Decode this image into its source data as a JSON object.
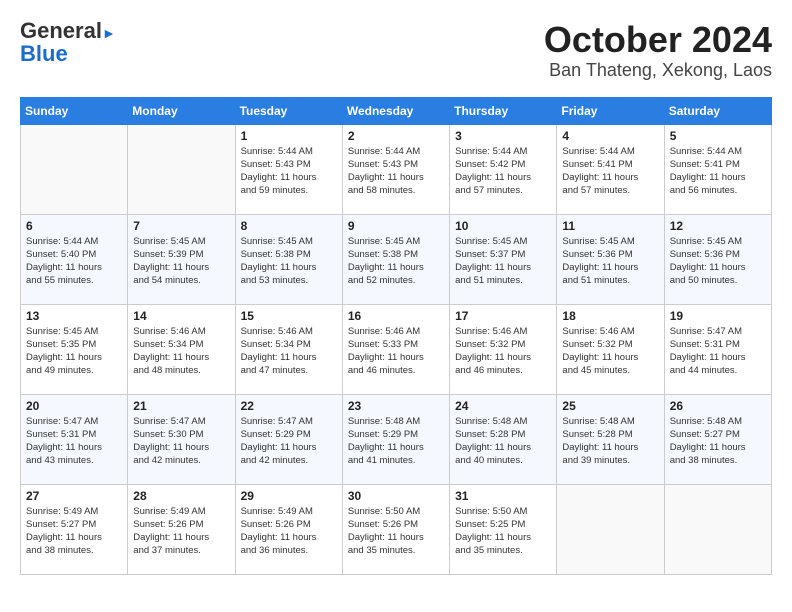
{
  "header": {
    "logo_general": "General",
    "logo_blue": "Blue",
    "title": "October 2024",
    "location": "Ban Thateng, Xekong, Laos"
  },
  "calendar": {
    "columns": [
      "Sunday",
      "Monday",
      "Tuesday",
      "Wednesday",
      "Thursday",
      "Friday",
      "Saturday"
    ],
    "weeks": [
      [
        {
          "day": "",
          "info": ""
        },
        {
          "day": "",
          "info": ""
        },
        {
          "day": "1",
          "info": "Sunrise: 5:44 AM\nSunset: 5:43 PM\nDaylight: 11 hours\nand 59 minutes."
        },
        {
          "day": "2",
          "info": "Sunrise: 5:44 AM\nSunset: 5:43 PM\nDaylight: 11 hours\nand 58 minutes."
        },
        {
          "day": "3",
          "info": "Sunrise: 5:44 AM\nSunset: 5:42 PM\nDaylight: 11 hours\nand 57 minutes."
        },
        {
          "day": "4",
          "info": "Sunrise: 5:44 AM\nSunset: 5:41 PM\nDaylight: 11 hours\nand 57 minutes."
        },
        {
          "day": "5",
          "info": "Sunrise: 5:44 AM\nSunset: 5:41 PM\nDaylight: 11 hours\nand 56 minutes."
        }
      ],
      [
        {
          "day": "6",
          "info": "Sunrise: 5:44 AM\nSunset: 5:40 PM\nDaylight: 11 hours\nand 55 minutes."
        },
        {
          "day": "7",
          "info": "Sunrise: 5:45 AM\nSunset: 5:39 PM\nDaylight: 11 hours\nand 54 minutes."
        },
        {
          "day": "8",
          "info": "Sunrise: 5:45 AM\nSunset: 5:38 PM\nDaylight: 11 hours\nand 53 minutes."
        },
        {
          "day": "9",
          "info": "Sunrise: 5:45 AM\nSunset: 5:38 PM\nDaylight: 11 hours\nand 52 minutes."
        },
        {
          "day": "10",
          "info": "Sunrise: 5:45 AM\nSunset: 5:37 PM\nDaylight: 11 hours\nand 51 minutes."
        },
        {
          "day": "11",
          "info": "Sunrise: 5:45 AM\nSunset: 5:36 PM\nDaylight: 11 hours\nand 51 minutes."
        },
        {
          "day": "12",
          "info": "Sunrise: 5:45 AM\nSunset: 5:36 PM\nDaylight: 11 hours\nand 50 minutes."
        }
      ],
      [
        {
          "day": "13",
          "info": "Sunrise: 5:45 AM\nSunset: 5:35 PM\nDaylight: 11 hours\nand 49 minutes."
        },
        {
          "day": "14",
          "info": "Sunrise: 5:46 AM\nSunset: 5:34 PM\nDaylight: 11 hours\nand 48 minutes."
        },
        {
          "day": "15",
          "info": "Sunrise: 5:46 AM\nSunset: 5:34 PM\nDaylight: 11 hours\nand 47 minutes."
        },
        {
          "day": "16",
          "info": "Sunrise: 5:46 AM\nSunset: 5:33 PM\nDaylight: 11 hours\nand 46 minutes."
        },
        {
          "day": "17",
          "info": "Sunrise: 5:46 AM\nSunset: 5:32 PM\nDaylight: 11 hours\nand 46 minutes."
        },
        {
          "day": "18",
          "info": "Sunrise: 5:46 AM\nSunset: 5:32 PM\nDaylight: 11 hours\nand 45 minutes."
        },
        {
          "day": "19",
          "info": "Sunrise: 5:47 AM\nSunset: 5:31 PM\nDaylight: 11 hours\nand 44 minutes."
        }
      ],
      [
        {
          "day": "20",
          "info": "Sunrise: 5:47 AM\nSunset: 5:31 PM\nDaylight: 11 hours\nand 43 minutes."
        },
        {
          "day": "21",
          "info": "Sunrise: 5:47 AM\nSunset: 5:30 PM\nDaylight: 11 hours\nand 42 minutes."
        },
        {
          "day": "22",
          "info": "Sunrise: 5:47 AM\nSunset: 5:29 PM\nDaylight: 11 hours\nand 42 minutes."
        },
        {
          "day": "23",
          "info": "Sunrise: 5:48 AM\nSunset: 5:29 PM\nDaylight: 11 hours\nand 41 minutes."
        },
        {
          "day": "24",
          "info": "Sunrise: 5:48 AM\nSunset: 5:28 PM\nDaylight: 11 hours\nand 40 minutes."
        },
        {
          "day": "25",
          "info": "Sunrise: 5:48 AM\nSunset: 5:28 PM\nDaylight: 11 hours\nand 39 minutes."
        },
        {
          "day": "26",
          "info": "Sunrise: 5:48 AM\nSunset: 5:27 PM\nDaylight: 11 hours\nand 38 minutes."
        }
      ],
      [
        {
          "day": "27",
          "info": "Sunrise: 5:49 AM\nSunset: 5:27 PM\nDaylight: 11 hours\nand 38 minutes."
        },
        {
          "day": "28",
          "info": "Sunrise: 5:49 AM\nSunset: 5:26 PM\nDaylight: 11 hours\nand 37 minutes."
        },
        {
          "day": "29",
          "info": "Sunrise: 5:49 AM\nSunset: 5:26 PM\nDaylight: 11 hours\nand 36 minutes."
        },
        {
          "day": "30",
          "info": "Sunrise: 5:50 AM\nSunset: 5:26 PM\nDaylight: 11 hours\nand 35 minutes."
        },
        {
          "day": "31",
          "info": "Sunrise: 5:50 AM\nSunset: 5:25 PM\nDaylight: 11 hours\nand 35 minutes."
        },
        {
          "day": "",
          "info": ""
        },
        {
          "day": "",
          "info": ""
        }
      ]
    ]
  }
}
